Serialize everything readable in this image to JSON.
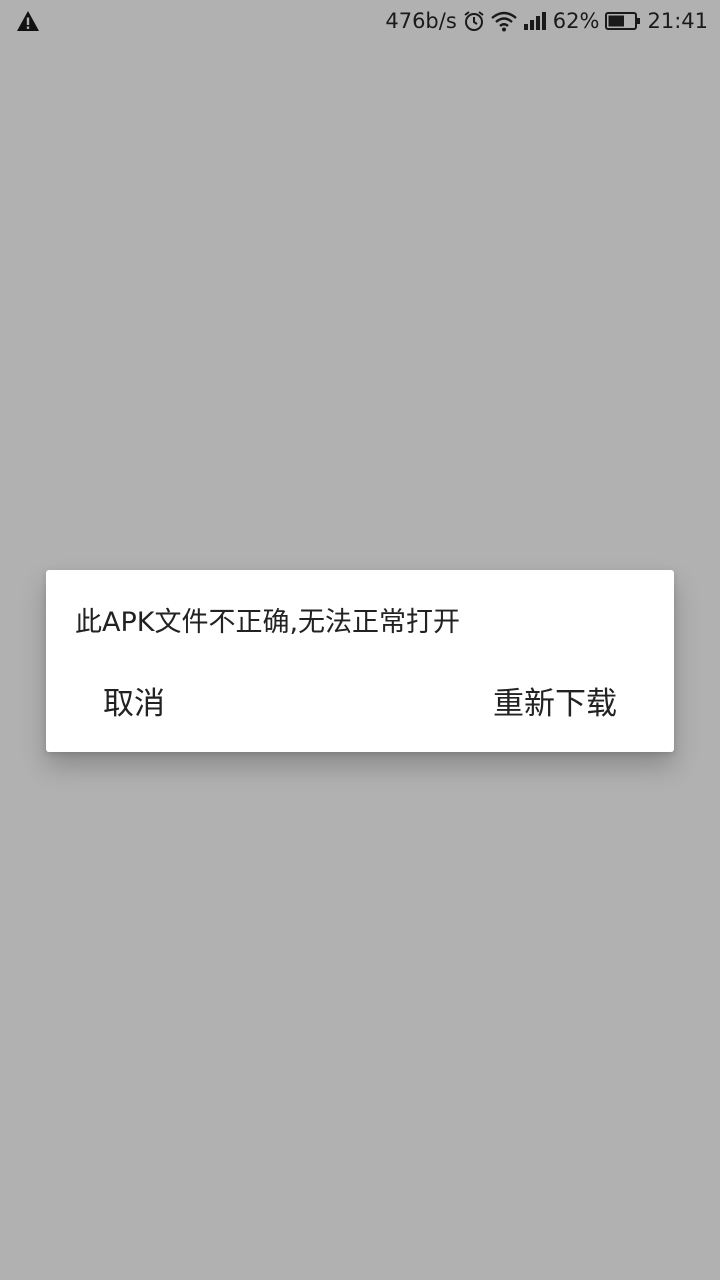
{
  "status_bar": {
    "warning_icon": "warning-triangle-icon",
    "network_speed": "476b/s",
    "alarm_icon": "alarm-clock-icon",
    "wifi_icon": "wifi-icon",
    "signal_icon": "signal-bars-icon",
    "battery_percent": "62%",
    "battery_level": 0.62,
    "battery_icon": "battery-icon",
    "time": "21:41"
  },
  "dialog": {
    "message": "此APK文件不正确,无法正常打开",
    "cancel_label": "取消",
    "redownload_label": "重新下载"
  },
  "colors": {
    "scrim": "#b1b1b1",
    "dialog_bg": "#ffffff",
    "text": "#222222"
  }
}
